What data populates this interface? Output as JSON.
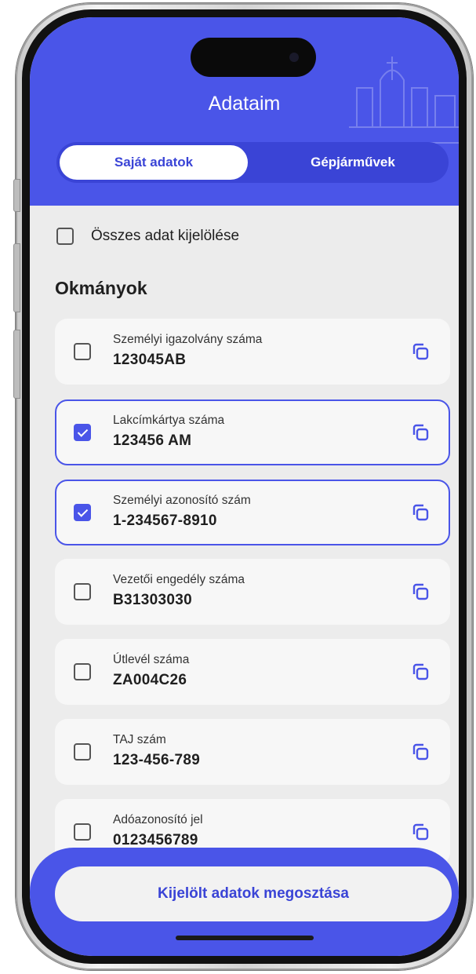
{
  "app": {
    "title": "Adataim"
  },
  "tabs": [
    {
      "label": "Saját adatok",
      "active": true
    },
    {
      "label": "Gépjárművek",
      "active": false
    }
  ],
  "select_all": {
    "label": "Összes adat kijelölése",
    "checked": false
  },
  "section": {
    "title": "Okmányok"
  },
  "documents": [
    {
      "label": "Személyi igazolvány száma",
      "value": "123045AB",
      "checked": false
    },
    {
      "label": "Lakcímkártya száma",
      "value": "123456 AM",
      "checked": true
    },
    {
      "label": "Személyi azonosító szám",
      "value": "1-234567-8910",
      "checked": true
    },
    {
      "label": "Vezetői engedély száma",
      "value": "B31303030",
      "checked": false
    },
    {
      "label": "Útlevél száma",
      "value": "ZA004C26",
      "checked": false
    },
    {
      "label": "TAJ szám",
      "value": "123-456-789",
      "checked": false
    },
    {
      "label": "Adóazonosító jel",
      "value": "0123456789",
      "checked": false
    }
  ],
  "share_button": {
    "label": "Kijelölt adatok megosztása"
  },
  "icons": {
    "copy": "copy-icon",
    "checkbox": "checkbox-icon"
  },
  "colors": {
    "brand": "#4a55e8",
    "brand_dark": "#3a44d6",
    "background": "#ececec",
    "card": "#f7f7f7"
  }
}
